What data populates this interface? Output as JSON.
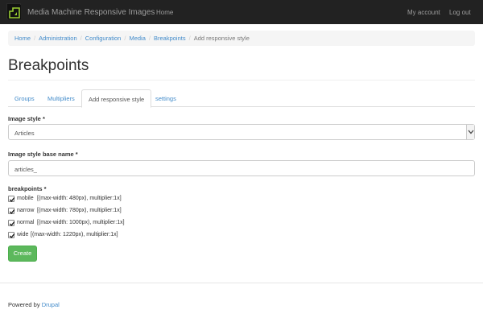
{
  "navbar": {
    "brand": "Media Machine Responsive Images",
    "home": "Home",
    "account": "My account",
    "logout": "Log out"
  },
  "breadcrumb": {
    "items": [
      "Home",
      "Administration",
      "Configuration",
      "Media",
      "Breakpoints"
    ],
    "current": "Add responsive style",
    "separator": "/"
  },
  "page": {
    "title": "Breakpoints"
  },
  "tabs": [
    {
      "label": "Groups",
      "active": false
    },
    {
      "label": "Multipliers",
      "active": false
    },
    {
      "label": "Add responsive style",
      "active": true
    },
    {
      "label": "settings",
      "active": false
    }
  ],
  "form": {
    "image_style": {
      "label": "Image style *",
      "value": "Articles"
    },
    "base_name": {
      "label": "Image style base name *",
      "value": "articles_"
    },
    "breakpoints": {
      "label": "breakpoints *",
      "items": [
        {
          "name": "mobile",
          "detail": "[(max-width: 480px), multiplier:1x]",
          "checked": true
        },
        {
          "name": "narrow",
          "detail": "[(max-width: 780px), multiplier:1x]",
          "checked": true
        },
        {
          "name": "normal",
          "detail": "[(max-width: 1000px), multiplier:1x]",
          "checked": true
        },
        {
          "name": "wide",
          "detail": "[(max-width: 1220px), multiplier:1x]",
          "checked": true
        }
      ]
    },
    "submit": "Create"
  },
  "footer": {
    "prefix": "Powered by",
    "link": "Drupal"
  },
  "colors": {
    "navbar": "#222222",
    "link": "#428bca",
    "button": "#5cb85c"
  }
}
